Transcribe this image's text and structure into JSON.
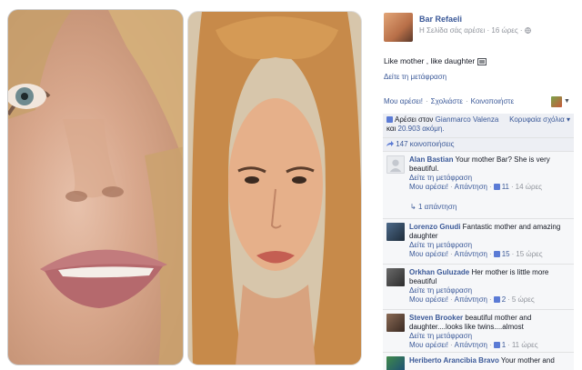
{
  "post": {
    "page_name": "Bar Refaeli",
    "page_meta": "Η Σελίδα σάς αρέσει · 16 ώρες ·",
    "globe_icon": "globe-icon",
    "caption": "Like mother , like daughter",
    "caption_emoji": "photo-emoticon-icon",
    "translate": "Δείτε τη μετάφραση",
    "actions": {
      "like": "Μου αρέσει!",
      "comment": "Σχολιάστε",
      "share": "Κοινοποιήστε"
    }
  },
  "likes": {
    "prefix": "Αρέσει στον",
    "liker": "Gianmarco Valenza",
    "and": "και",
    "others": "20.903 ακόμη.",
    "top_comments": "Κορυφαία σχόλια ▾"
  },
  "shares": {
    "label": "147 κοινοποιήσεις"
  },
  "comments": [
    {
      "author": "Alan Bastian",
      "text": "Your mother Bar? She is very beautiful.",
      "translate": "Δείτε τη μετάφραση",
      "like": "Μου αρέσει!",
      "reply": "Απάντηση",
      "likes_count": "11",
      "time": "14 ώρες",
      "replies": "1 απάντηση"
    },
    {
      "author": "Lorenzo Gnudi",
      "text": "Fantastic mother and amazing daughter",
      "translate": "Δείτε τη μετάφραση",
      "like": "Μου αρέσει!",
      "reply": "Απάντηση",
      "likes_count": "15",
      "time": "15 ώρες"
    },
    {
      "author": "Orkhan Guluzade",
      "text": "Her mother is little more beautiful",
      "translate": "Δείτε τη μετάφραση",
      "like": "Μου αρέσει!",
      "reply": "Απάντηση",
      "likes_count": "2",
      "time": "5 ώρες"
    },
    {
      "author": "Steven Brooker",
      "text": "beautiful mother and daughter....looks like twins....almost",
      "translate": "Δείτε τη μετάφραση",
      "like": "Μου αρέσει!",
      "reply": "Απάντηση",
      "likes_count": "1",
      "time": "11 ώρες"
    },
    {
      "author": "Heriberto Arancibia Bravo",
      "text": "Your mother and"
    }
  ],
  "colors": {
    "link": "#3b5998",
    "meta": "#90949c",
    "panel": "#edeff4"
  }
}
